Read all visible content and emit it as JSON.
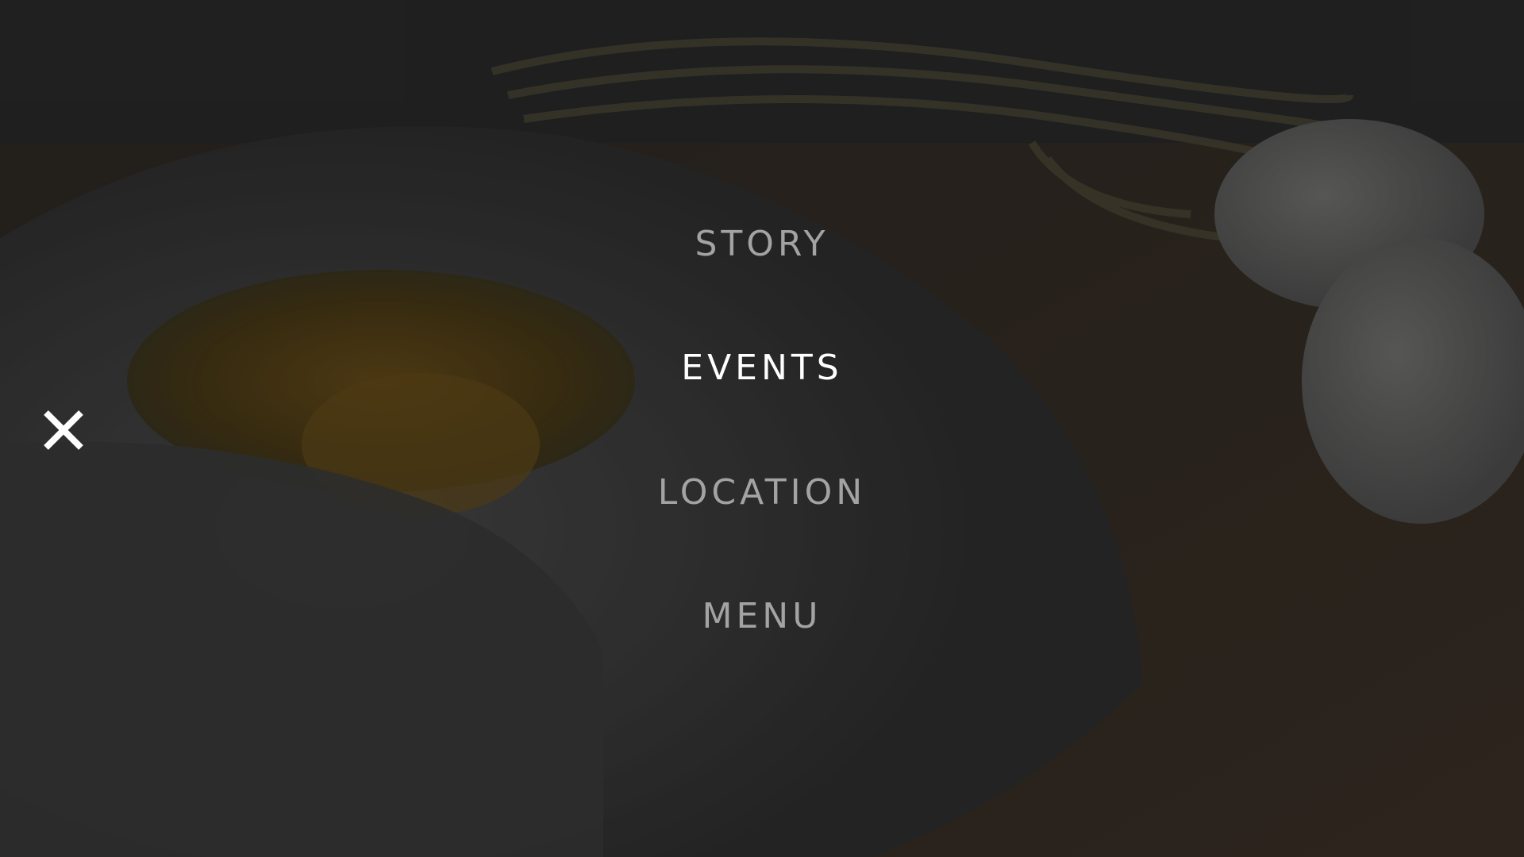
{
  "nav": {
    "items": [
      {
        "label": "STORY",
        "active": false
      },
      {
        "label": "EVENTS",
        "active": true
      },
      {
        "label": "LOCATION",
        "active": false
      },
      {
        "label": "MENU",
        "active": false
      }
    ]
  },
  "icons": {
    "close": "close-icon"
  },
  "colors": {
    "active_text": "#ffffff",
    "inactive_text": "#a3a3a3",
    "overlay": "#1f1f1f"
  }
}
